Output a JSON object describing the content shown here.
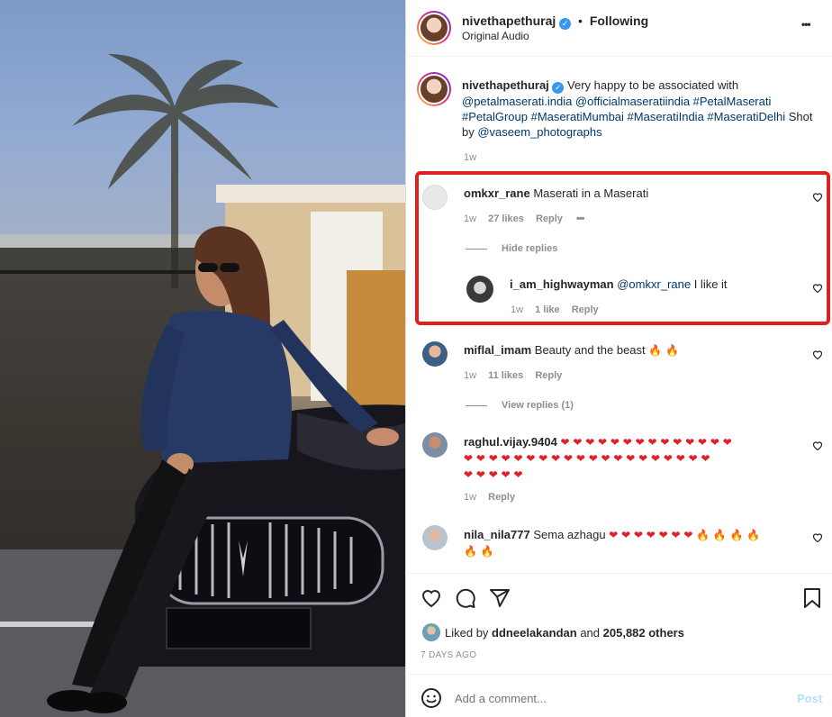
{
  "header": {
    "username": "nivethapethuraj",
    "dot": "•",
    "follow_status": "Following",
    "audio": "Original Audio",
    "more_label": "•••"
  },
  "caption": {
    "username": "nivethapethuraj",
    "text_start": "Very happy to be associated with",
    "tags_line1": "@petalmaserati.india @officialmaseratiindia #PetalMaserati",
    "tags_line2": "#PetalGroup #MaseratiMumbai #MaseratiIndia #MaseratiDelhi",
    "shot": "Shot",
    "by": "by",
    "credit": "@vaseem_photographs",
    "time": "1w"
  },
  "comments": [
    {
      "username": "omkxr_rane",
      "text": "Maserati in a Maserati",
      "time": "1w",
      "likes": "27 likes",
      "reply": "Reply",
      "more": "•••",
      "replies_toggle": "Hide replies"
    },
    {
      "username": "i_am_highwayman",
      "mention": "@omkxr_rane",
      "text": "I like it",
      "time": "1w",
      "likes": "1 like",
      "reply": "Reply"
    },
    {
      "username": "miflal_imam",
      "text": "Beauty and the beast",
      "emoji": "🔥 🔥",
      "time": "1w",
      "likes": "11 likes",
      "reply": "Reply",
      "replies_toggle": "View replies (1)"
    },
    {
      "username": "raghul.vijay.9404",
      "emoji_line1": "❤ ❤ ❤ ❤ ❤ ❤ ❤ ❤ ❤ ❤ ❤ ❤ ❤ ❤",
      "emoji_line2": "❤ ❤ ❤ ❤ ❤ ❤ ❤ ❤ ❤ ❤ ❤ ❤ ❤ ❤ ❤ ❤ ❤ ❤ ❤ ❤",
      "emoji_line3": "❤ ❤ ❤ ❤ ❤",
      "time": "1w",
      "reply": "Reply"
    },
    {
      "username": "nila_nila777",
      "text": "Sema azhagu",
      "hearts": "❤ ❤ ❤ ❤ ❤ ❤ ❤",
      "fires": "🔥 🔥 🔥 🔥",
      "fires_line2": "🔥 🔥"
    }
  ],
  "likes": {
    "prefix": "Liked by",
    "user": "ddneelakandan",
    "and": "and",
    "others": "205,882 others",
    "date": "7 DAYS AGO"
  },
  "composer": {
    "placeholder": "Add a comment...",
    "post": "Post"
  },
  "icons": {
    "like": "heart-outline-icon",
    "comment": "comment-bubble-icon",
    "share": "paper-plane-icon",
    "save": "bookmark-icon",
    "emoji": "smiley-icon"
  },
  "colors": {
    "highlight": "#e02020",
    "link": "#00376b",
    "muted": "#8e8e8e",
    "post_button": "#b2dffc"
  }
}
